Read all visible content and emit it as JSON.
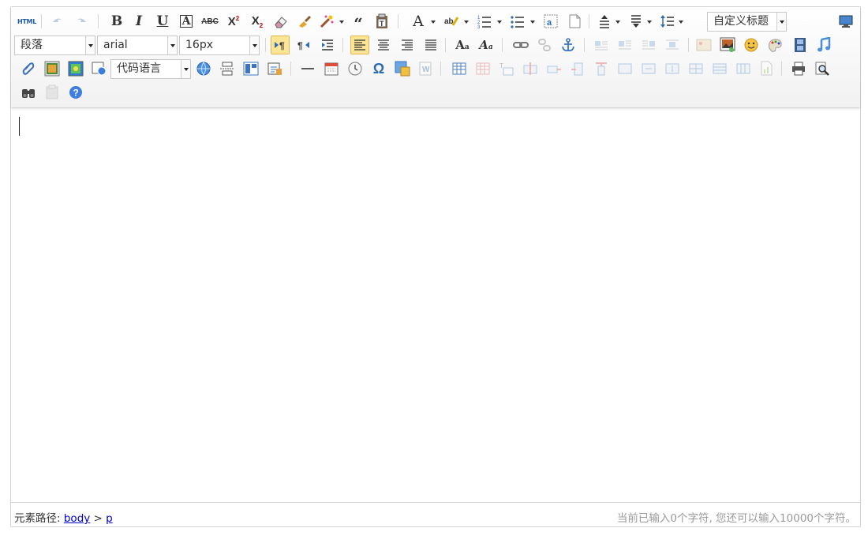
{
  "toolbar": {
    "source_label": "HTML",
    "paragraph": {
      "value": "段落"
    },
    "font_family": {
      "value": "arial"
    },
    "font_size": {
      "value": "16px"
    },
    "code_language": {
      "value": "代码语言"
    },
    "custom_heading": {
      "value": "自定义标题"
    }
  },
  "statusbar": {
    "path_label": "元素路径:",
    "path": [
      "body",
      "p"
    ],
    "path_sep": ">",
    "word_count": "当前已输入0个字符, 您还可以输入10000个字符。"
  },
  "colors": {
    "active": "#fde596",
    "link": "#0000cc",
    "muted": "#999999"
  }
}
